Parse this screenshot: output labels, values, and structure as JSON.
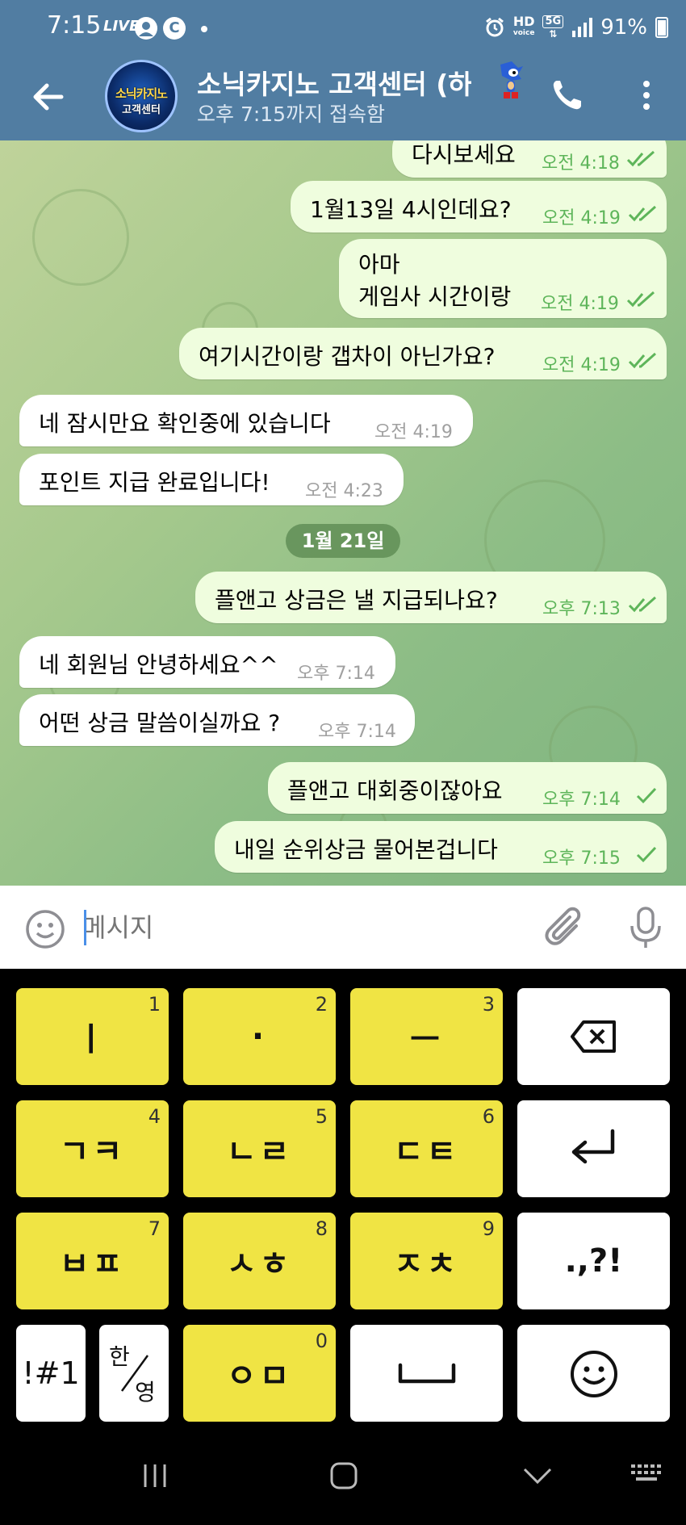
{
  "status_bar": {
    "time": "7:15",
    "live": "LIVE",
    "icon_c": "C",
    "hd_top": "HD",
    "hd_bottom": "voice",
    "network": "5G",
    "battery": "91%"
  },
  "header": {
    "title": "소닉카지노 고객센터 (하",
    "status": "오후 7:15까지 접속함",
    "avatar_text": "소닉카지노",
    "avatar_sub": "고객센터"
  },
  "messages": [
    {
      "dir": "out",
      "text": "다시보세요",
      "time": "오전 4:18",
      "read": true
    },
    {
      "dir": "out",
      "text": "1월13일 4시인데요?",
      "time": "오전 4:19",
      "read": true
    },
    {
      "dir": "out",
      "text": "아마",
      "text2": "게임사 시간이랑",
      "time": "오전 4:19",
      "read": true
    },
    {
      "dir": "out",
      "text": "여기시간이랑 갭차이 아닌가요?",
      "time": "오전 4:19",
      "read": true
    },
    {
      "dir": "in",
      "text": "네 잠시만요 확인중에 있습니다",
      "time": "오전 4:19"
    },
    {
      "dir": "in",
      "text": "포인트 지급 완료입니다!",
      "time": "오전 4:23"
    },
    {
      "dir": "out",
      "text": "플앤고 상금은 낼 지급되나요?",
      "time": "오후 7:13",
      "read": true
    },
    {
      "dir": "in",
      "text": "네 회원님 안녕하세요^^",
      "time": "오후 7:14"
    },
    {
      "dir": "in",
      "text": "어떤 상금 말씀이실까요 ?",
      "time": "오후 7:14"
    },
    {
      "dir": "out",
      "text": "플앤고 대회중이잖아요",
      "time": "오후 7:14",
      "read": false
    },
    {
      "dir": "out",
      "text": "내일 순위상금 물어본겁니다",
      "time": "오후 7:15",
      "read": false
    }
  ],
  "date_separator": "1월 21일",
  "input": {
    "placeholder": "메시지"
  },
  "keyboard": {
    "keys": [
      {
        "label": "ㅣ",
        "num": "1"
      },
      {
        "label": "·",
        "num": "2"
      },
      {
        "label": "ㅡ",
        "num": "3"
      },
      {
        "label": "ㄱㅋ",
        "num": "4"
      },
      {
        "label": "ㄴㄹ",
        "num": "5"
      },
      {
        "label": "ㄷㅌ",
        "num": "6"
      },
      {
        "label": "ㅂㅍ",
        "num": "7"
      },
      {
        "label": "ㅅㅎ",
        "num": "8"
      },
      {
        "label": "ㅈㅊ",
        "num": "9"
      },
      {
        "label": "ㅇㅁ",
        "num": "0"
      }
    ],
    "punct": ".,?!",
    "symbols": "!#1",
    "lang_top": "한",
    "lang_bottom": "영"
  },
  "colors": {
    "header_bg": "#517da2",
    "out_bubble": "#effdde",
    "in_bubble": "#ffffff",
    "out_time": "#5eb55a",
    "key_yellow": "#f0e444"
  }
}
